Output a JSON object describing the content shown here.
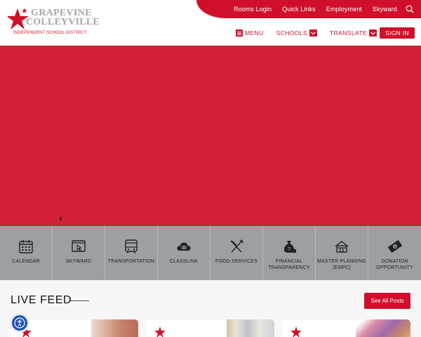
{
  "logo": {
    "line1": "GRAPEVINE",
    "line2": "COLLEYVILLE",
    "line3": "INDEPENDENT SCHOOL DISTRICT",
    "icon": "star-logo-icon"
  },
  "utility_nav": {
    "items": [
      "Rooms Login",
      "Quick Links",
      "Employment",
      "Skyward"
    ],
    "search_icon": "search-icon"
  },
  "main_nav": {
    "menu": "MENU",
    "schools": "SCHOOLS",
    "translate": "TRANSLATE",
    "sign_in": "SIGN IN"
  },
  "quick_links": [
    {
      "label": "CALENDAR",
      "icon": "calendar-icon"
    },
    {
      "label": "SKYWARD",
      "icon": "skyward-icon"
    },
    {
      "label": "TRANSPORTATION",
      "icon": "bus-icon"
    },
    {
      "label": "CLASSLINK",
      "icon": "cloud-link-icon"
    },
    {
      "label": "FOOD SERVICES",
      "icon": "fork-knife-icon"
    },
    {
      "label": "FINANCIAL\nTRANSPARENCY",
      "icon": "money-bag-icon"
    },
    {
      "label": "MASTER PLANNING\n(EMPC)",
      "icon": "building-icon"
    },
    {
      "label": "DONATION\nOPPORTUNITY",
      "icon": "donation-icon"
    }
  ],
  "live_feed": {
    "title": "LIVE FEED",
    "see_all": "See All Posts"
  },
  "colors": {
    "brand_red": "#d0102a",
    "hero_red": "#d11f35",
    "quicklinks_gray": "#9da0a3",
    "logo_gray": "#a5a5ab"
  }
}
